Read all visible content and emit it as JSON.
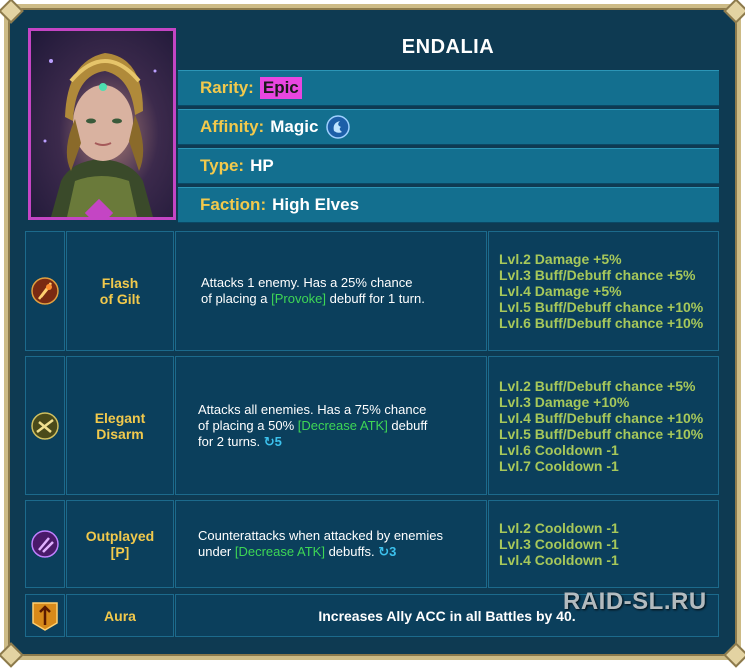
{
  "header": {
    "name": "ENDALIA"
  },
  "info": [
    {
      "label": "Rarity:",
      "value": "Epic"
    },
    {
      "label": "Affinity:",
      "value": "Magic"
    },
    {
      "label": "Type:",
      "value": "HP"
    },
    {
      "label": "Faction:",
      "value": "High Elves"
    }
  ],
  "skills": [
    {
      "name_line1": "Flash",
      "name_line2": "of Gilt",
      "desc_a": "Attacks 1 enemy. Has a 25% chance",
      "desc_b": "of placing a ",
      "desc_tag": "[Provoke]",
      "desc_c": " debuff for 1 turn.",
      "levels": [
        "Lvl.2 Damage +5%",
        "Lvl.3 Buff/Debuff chance +5%",
        "Lvl.4 Damage +5%",
        "Lvl.5 Buff/Debuff chance +10%",
        "Lvl.6 Buff/Debuff chance +10%"
      ]
    },
    {
      "name_line1": "Elegant",
      "name_line2": "Disarm",
      "desc_a": "Attacks all enemies. Has a 75% chance",
      "desc_b": "of placing a 50% ",
      "desc_tag": "[Decrease ATK]",
      "desc_c": " debuff",
      "desc_d": "for 2 turns. ",
      "cooldown": "5",
      "levels": [
        "Lvl.2 Buff/Debuff chance +5%",
        "Lvl.3 Damage +10%",
        "Lvl.4 Buff/Debuff chance +10%",
        "Lvl.5 Buff/Debuff chance +10%",
        "Lvl.6 Cooldown -1",
        "Lvl.7 Cooldown -1"
      ]
    },
    {
      "name_line1": "Outplayed",
      "name_line2": "[P]",
      "desc_a": "Counterattacks when attacked by enemies",
      "desc_b": "under ",
      "desc_tag": "[Decrease ATK]",
      "desc_c": " debuffs. ",
      "cooldown": "3",
      "levels": [
        "Lvl.2 Cooldown -1",
        "Lvl.3 Cooldown -1",
        "Lvl.4 Cooldown -1"
      ]
    }
  ],
  "aura": {
    "name": "Aura",
    "text": "Increases Ally ACC in all Battles by 40."
  },
  "watermark": "RAID-SL.RU",
  "colors": {
    "epic": "#e946e0",
    "label": "#f2c94c",
    "levels": "#a7c85a",
    "debuff": "#3ed655",
    "cooldown": "#3cc2ee"
  }
}
